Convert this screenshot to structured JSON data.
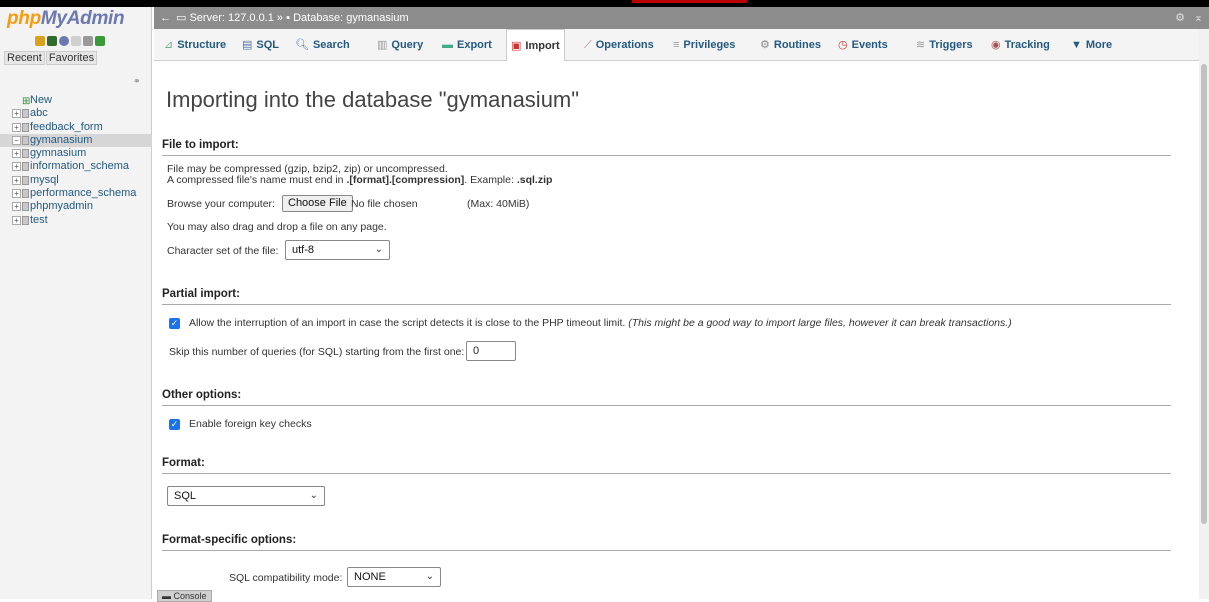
{
  "sidebar": {
    "logo_main": "php",
    "logo_accent": "MyAdmin",
    "recent_tab": "Recent",
    "favorites_tab": "Favorites",
    "databases": [
      {
        "name": "New"
      },
      {
        "name": "abc"
      },
      {
        "name": "feedback_form"
      },
      {
        "name": "gymanasium"
      },
      {
        "name": "gymnasium"
      },
      {
        "name": "information_schema"
      },
      {
        "name": "mysql"
      },
      {
        "name": "performance_schema"
      },
      {
        "name": "phpmyadmin"
      },
      {
        "name": "test"
      }
    ],
    "active_database": "gymanasium"
  },
  "breadcrumb": {
    "server": "Server: 127.0.0.1",
    "separator": "»",
    "database": "Database: gymanasium"
  },
  "tabs": [
    {
      "label": "Structure",
      "icon": "structure-icon"
    },
    {
      "label": "SQL",
      "icon": "sql-icon"
    },
    {
      "label": "Search",
      "icon": "search-icon"
    },
    {
      "label": "Query",
      "icon": "query-icon"
    },
    {
      "label": "Export",
      "icon": "export-icon"
    },
    {
      "label": "Import",
      "icon": "import-icon",
      "active": true
    },
    {
      "label": "Operations",
      "icon": "wrench-icon"
    },
    {
      "label": "Privileges",
      "icon": "privileges-icon"
    },
    {
      "label": "Routines",
      "icon": "routines-icon"
    },
    {
      "label": "Events",
      "icon": "clock-icon"
    },
    {
      "label": "Triggers",
      "icon": "triggers-icon"
    },
    {
      "label": "Tracking",
      "icon": "tracking-icon"
    },
    {
      "label": "More",
      "icon": "chevron-down-icon"
    }
  ],
  "page": {
    "title": "Importing into the database \"gymanasium\"",
    "file_section": {
      "heading": "File to import:",
      "compress_note": "File may be compressed (gzip, bzip2, zip) or uncompressed.",
      "name_note_prefix": "A compressed file's name must end in ",
      "name_note_format": ".[format].[compression]",
      "name_note_example_label": ". Example: ",
      "name_note_example": ".sql.zip",
      "browse_label": "Browse your computer:",
      "choose_file_button": "Choose File",
      "no_file": "No file chosen",
      "max_size": "(Max: 40MiB)",
      "drag_note": "You may also drag and drop a file on any page.",
      "charset_label": "Character set of the file:",
      "charset_value": "utf-8"
    },
    "partial_section": {
      "heading": "Partial import:",
      "allow_interrupt_label": "Allow the interruption of an import in case the script detects it is close to the PHP timeout limit.",
      "allow_interrupt_hint": "(This might be a good way to import large files, however it can break transactions.)",
      "allow_interrupt_checked": true,
      "skip_label": "Skip this number of queries (for SQL) starting from the first one:",
      "skip_value": "0"
    },
    "other_section": {
      "heading": "Other options:",
      "fk_label": "Enable foreign key checks",
      "fk_checked": true
    },
    "format_section": {
      "heading": "Format:",
      "format_value": "SQL"
    },
    "format_specific_section": {
      "heading": "Format-specific options:",
      "compat_label": "SQL compatibility mode:",
      "compat_value": "NONE"
    },
    "console_label": "Console"
  }
}
